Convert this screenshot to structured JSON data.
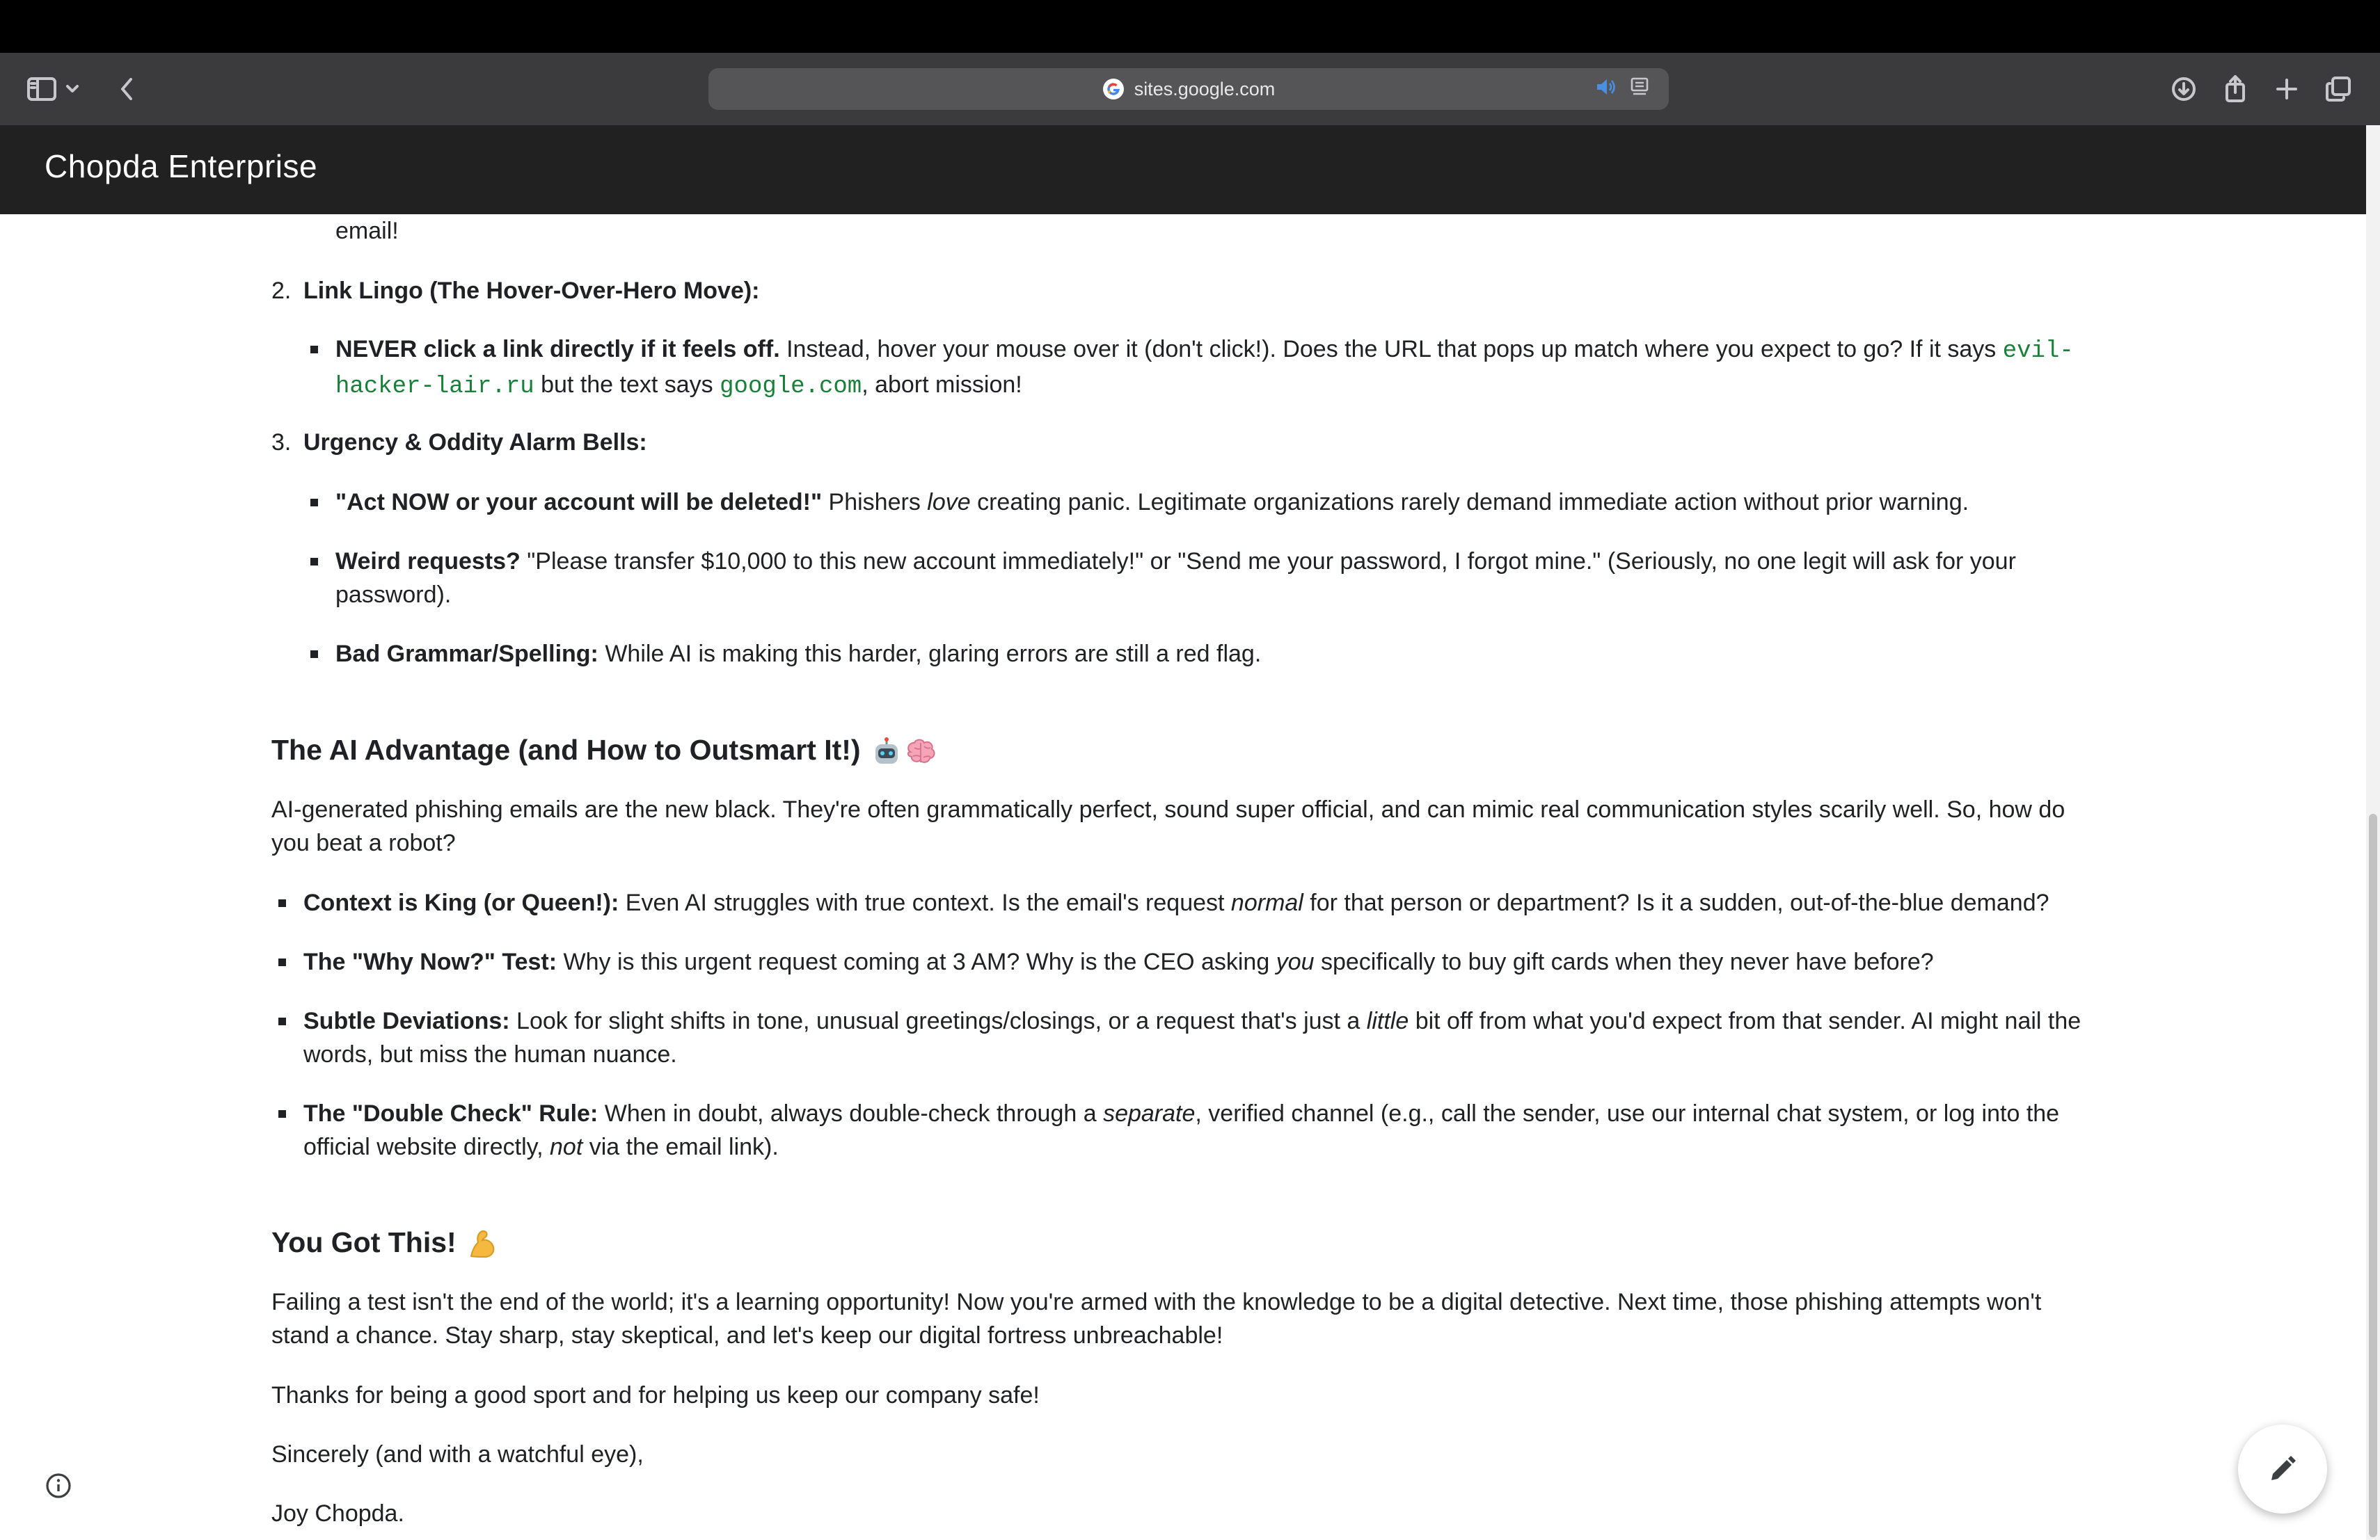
{
  "browser": {
    "url": "sites.google.com",
    "icons": [
      "sidebar-icon",
      "chevron-down-icon",
      "back-icon",
      "google-logo-icon",
      "speaker-icon",
      "reader-icon",
      "download-icon",
      "share-icon",
      "new-tab-icon",
      "tabs-overview-icon"
    ]
  },
  "site": {
    "title": "Chopda Enterprise"
  },
  "content": {
    "fragment": "email!",
    "item2": {
      "num": "2.",
      "label": "Link Lingo (The Hover-Over-Hero Move):",
      "bullet": {
        "bold": "NEVER click a link directly if it feels off.",
        "t1": " Instead, hover your mouse over it (don't click!). Does the URL that pops up match where you expect to go? If it says ",
        "code1": "evil-hacker-lair.ru",
        "t2": " but the text says ",
        "code2": "google.com",
        "t3": ", abort mission!"
      }
    },
    "item3": {
      "num": "3.",
      "label": "Urgency & Oddity Alarm Bells:",
      "b1": {
        "bold": "\"Act NOW or your account will be deleted!\"",
        "t1": " Phishers ",
        "em": "love",
        "t2": " creating panic. Legitimate organizations rarely demand immediate action without prior warning."
      },
      "b2": {
        "bold": "Weird requests?",
        "t1": " \"Please transfer $10,000 to this new account immediately!\" or \"Send me your password, I forgot mine.\" (Seriously, no one legit will ask for your password)."
      },
      "b3": {
        "bold": "Bad Grammar/Spelling:",
        "t1": " While AI is making this harder, glaring errors are still a red flag."
      }
    },
    "ai_section": {
      "heading": "The AI Advantage (and How to Outsmart It!)",
      "heading_emoji": [
        "robot-emoji",
        "brain-emoji"
      ],
      "intro": "AI-generated phishing emails are the new black. They're often grammatically perfect, sound super official, and can mimic real communication styles scarily well. So, how do you beat a robot?",
      "bullets": [
        {
          "bold": "Context is King (or Queen!):",
          "t1": " Even AI struggles with true context. Is the email's request ",
          "em": "normal",
          "t2": " for that person or department? Is it a sudden, out-of-the-blue demand?"
        },
        {
          "bold": "The \"Why Now?\" Test:",
          "t1": " Why is this urgent request coming at 3 AM? Why is the CEO asking ",
          "em": "you",
          "t2": " specifically to buy gift cards when they never have before?"
        },
        {
          "bold": "Subtle Deviations:",
          "t1": " Look for slight shifts in tone, unusual greetings/closings, or a request that's just a ",
          "em": "little",
          "t2": " bit off from what you'd expect from that sender. AI might nail the words, but miss the human nuance."
        },
        {
          "bold": "The \"Double Check\" Rule:",
          "t1": " When in doubt, always double-check through a ",
          "em": "separate",
          "t2": ", verified channel (e.g., call the sender, use our internal chat system, or log into the official website directly, ",
          "em2": "not",
          "t3": " via the email link)."
        }
      ]
    },
    "closing": {
      "heading": "You Got This!",
      "heading_emoji": "flexed-biceps-emoji",
      "p1": "Failing a test isn't the end of the world; it's a learning opportunity! Now you're armed with the knowledge to be a digital detective. Next time, those phishing attempts won't stand a chance. Stay sharp, stay skeptical, and let's keep our digital fortress unbreachable!",
      "p2": "Thanks for being a good sport and for helping us keep our company safe!",
      "p3": "Sincerely (and with a watchful eye),",
      "p4": "Joy Chopda."
    }
  },
  "controls": {
    "info": "info-icon",
    "edit": "pencil-icon"
  },
  "colors": {
    "header": "#212121",
    "code": "#188038",
    "text": "#202124",
    "toolbar": "#3b3b3d"
  }
}
